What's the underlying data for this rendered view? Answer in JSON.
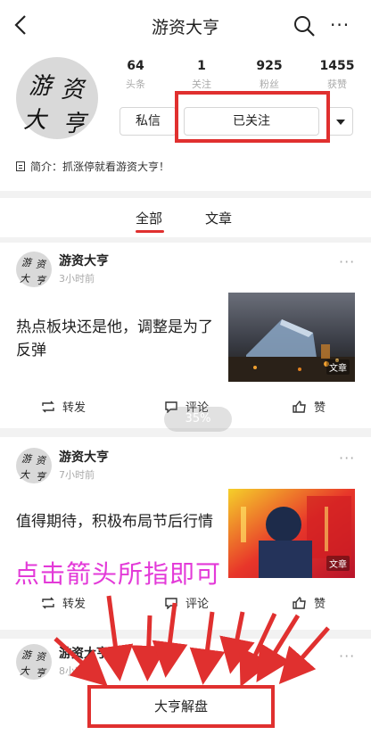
{
  "header": {
    "title": "游资大亨",
    "back_icon": "back-arrow-icon",
    "search_icon": "search-icon",
    "more_icon": "more-dots-icon",
    "more_text": "···"
  },
  "profile": {
    "avatar_chars": [
      "游",
      "资",
      "大",
      "亨"
    ],
    "stats": [
      {
        "value": "64",
        "label": "头条"
      },
      {
        "value": "1",
        "label": "关注"
      },
      {
        "value": "925",
        "label": "粉丝"
      },
      {
        "value": "1455",
        "label": "获赞"
      }
    ],
    "message_button": "私信",
    "followed_button": "已关注",
    "bio": "简介：抓涨停就看游资大亨！"
  },
  "tabs": [
    {
      "label": "全部",
      "active": true
    },
    {
      "label": "文章",
      "active": false
    }
  ],
  "posts": [
    {
      "author": "游资大亨",
      "time": "3小时前",
      "headline": "热点板块还是他，调整是为了反弹",
      "thumb_tag": "文章",
      "repost": "转发",
      "comment": "评论",
      "like": "赞",
      "more": "···"
    },
    {
      "author": "游资大亨",
      "time": "7小时前",
      "headline": "值得期待，积极布局节后行情",
      "thumb_tag": "文章",
      "repost": "转发",
      "comment": "评论",
      "like": "赞",
      "more": "···"
    },
    {
      "author": "游资大亨",
      "time": "8小时前",
      "more": "···"
    }
  ],
  "scroll_percent_badge": "35%",
  "overlay_instruction": "点击箭头所指即可",
  "bottom_button": "大亨解盘",
  "colors": {
    "accent_red": "#e0302f",
    "overlay_magenta": "#e33ad8"
  }
}
